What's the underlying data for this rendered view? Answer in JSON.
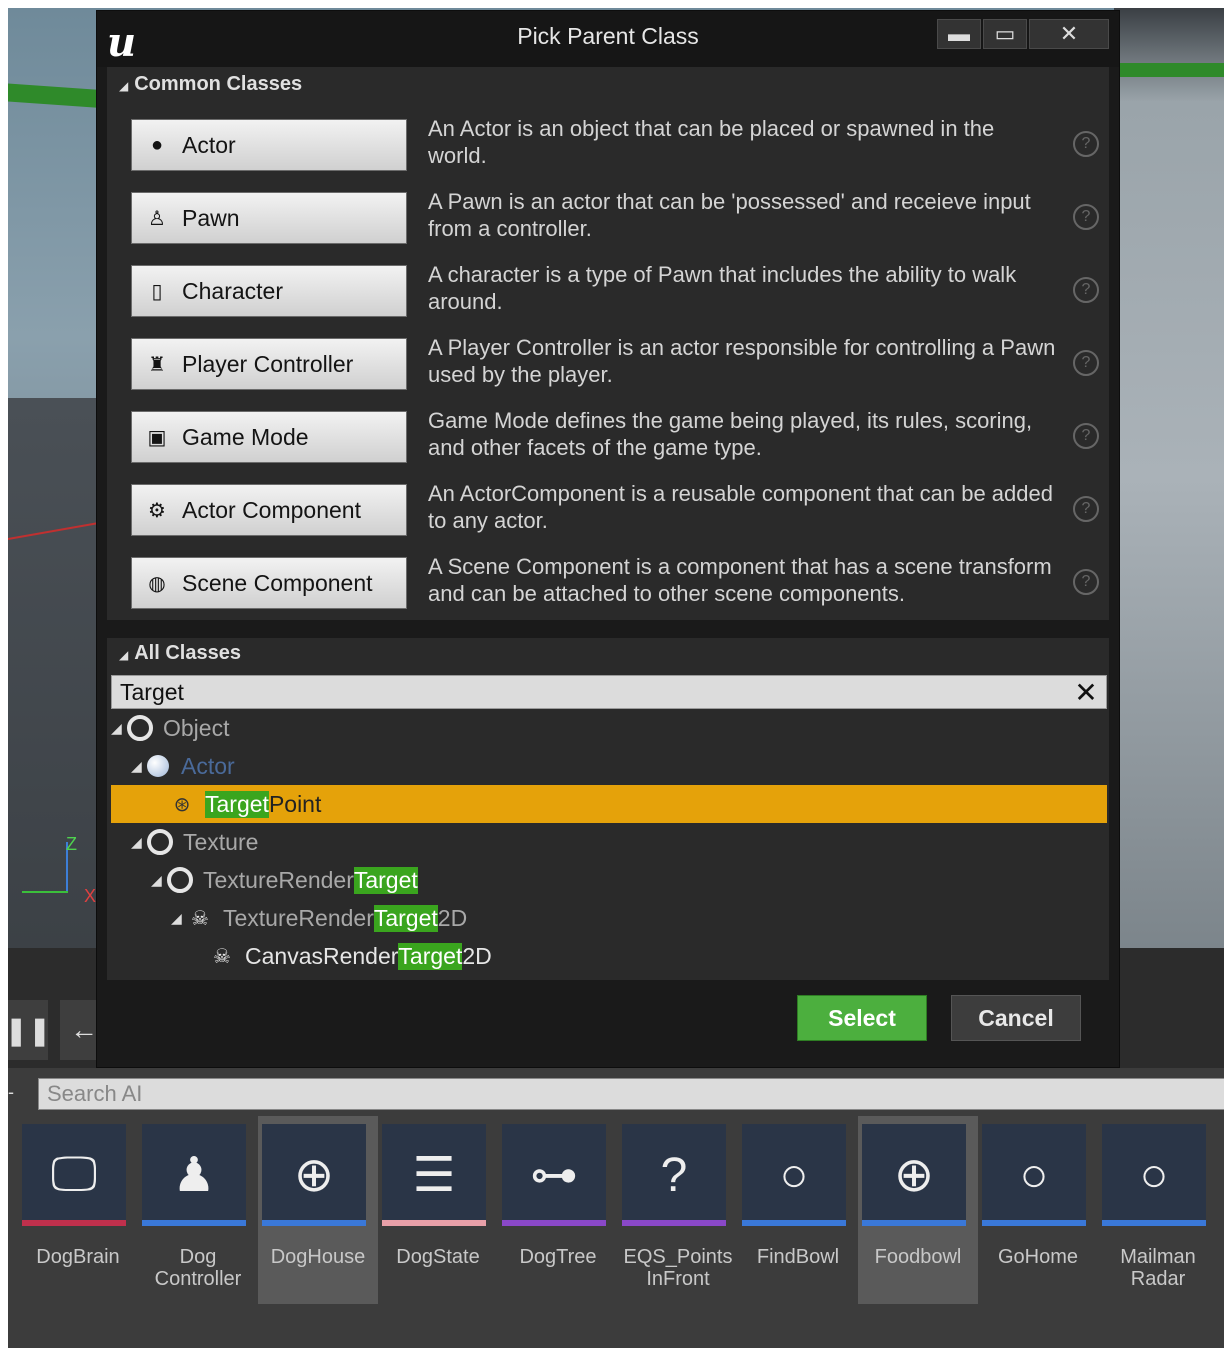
{
  "dialog": {
    "title": "Pick Parent Class",
    "minimize_icon": "minimize-icon",
    "maximize_icon": "maximize-icon",
    "close_icon": "close-icon"
  },
  "common_classes": {
    "header": "Common Classes",
    "items": [
      {
        "label": "Actor",
        "icon": "actor-sphere-icon",
        "desc": "An Actor is an object that can be placed or spawned in the world."
      },
      {
        "label": "Pawn",
        "icon": "pawn-icon",
        "desc": "A Pawn is an actor that can be 'possessed' and receieve input from a controller."
      },
      {
        "label": "Character",
        "icon": "character-capsule-icon",
        "desc": "A character is a type of Pawn that includes the ability to walk around."
      },
      {
        "label": "Player Controller",
        "icon": "player-controller-icon",
        "desc": "A Player Controller is an actor responsible for controlling a Pawn used by the player."
      },
      {
        "label": "Game Mode",
        "icon": "game-mode-icon",
        "desc": "Game Mode defines the game being played, its rules, scoring, and other facets of the game type."
      },
      {
        "label": "Actor Component",
        "icon": "actor-component-icon",
        "desc": "An ActorComponent is a reusable component that can be added to any actor."
      },
      {
        "label": "Scene Component",
        "icon": "scene-component-icon",
        "desc": "A Scene Component is a component that has a scene transform and can be attached to other scene components."
      }
    ]
  },
  "all_classes": {
    "header": "All Classes",
    "search_value": "Target",
    "tree": {
      "object": "Object",
      "actor": "Actor",
      "target_point": {
        "hl": "Target",
        "rest": "Point"
      },
      "texture": "Texture",
      "trt": {
        "pre": "TextureRender",
        "hl": "Target"
      },
      "trt2d": {
        "pre": "TextureRender",
        "hl": "Target",
        "post": "2D"
      },
      "crt2d": {
        "pre": "CanvasRender",
        "hl": "Target",
        "post": "2D"
      }
    }
  },
  "buttons": {
    "select": "Select",
    "cancel": "Cancel"
  },
  "viewport": {
    "axis_z": "Z",
    "axis_x": "X"
  },
  "content_browser": {
    "search_placeholder": "Search AI",
    "assets": [
      {
        "line1": "DogBrain",
        "line2": "",
        "bar": "#c0304c"
      },
      {
        "line1": "Dog",
        "line2": "Controller",
        "bar": "#3a78d8"
      },
      {
        "line1": "DogHouse",
        "line2": "",
        "bar": "#3a78d8"
      },
      {
        "line1": "DogState",
        "line2": "",
        "bar": "#e8a0a8"
      },
      {
        "line1": "DogTree",
        "line2": "",
        "bar": "#8a48c8"
      },
      {
        "line1": "EQS_Points",
        "line2": "InFront",
        "bar": "#8a48c8"
      },
      {
        "line1": "FindBowl",
        "line2": "",
        "bar": "#3a78d8"
      },
      {
        "line1": "Foodbowl",
        "line2": "",
        "bar": "#3a78d8"
      },
      {
        "line1": "GoHome",
        "line2": "",
        "bar": "#3a78d8"
      },
      {
        "line1": "Mailman",
        "line2": "Radar",
        "bar": "#3a78d8"
      }
    ]
  }
}
